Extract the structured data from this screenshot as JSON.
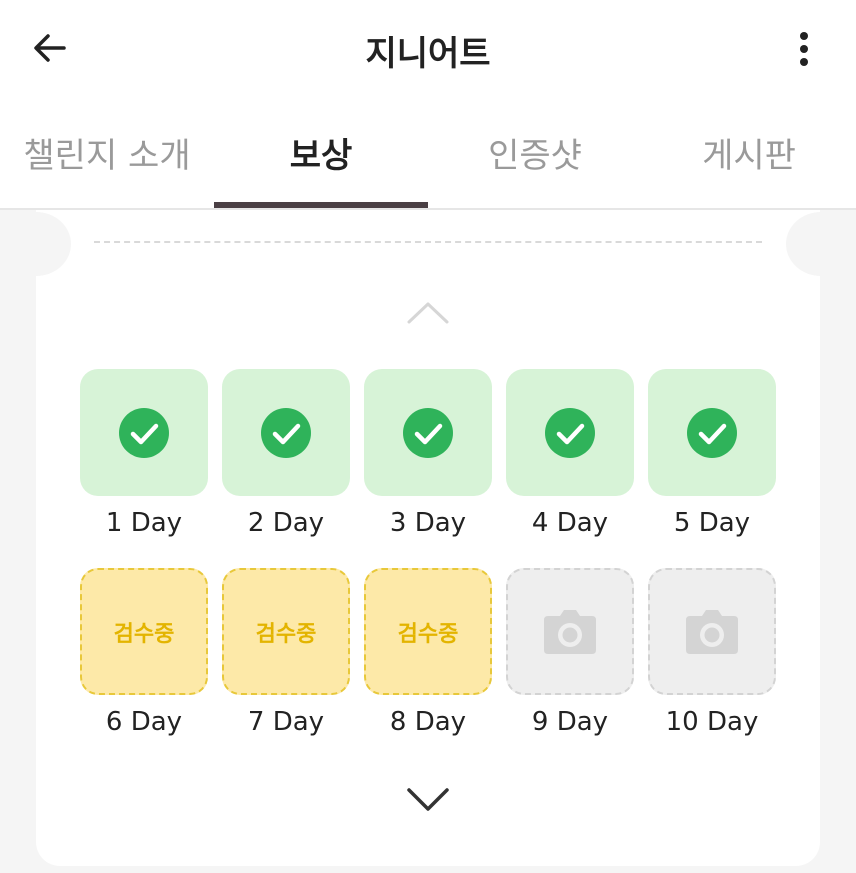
{
  "header": {
    "title": "지니어트",
    "back_icon": "arrow-left-icon",
    "more_icon": "more-vertical-icon"
  },
  "tabs": [
    {
      "label": "챌린지 소개",
      "active": false
    },
    {
      "label": "보상",
      "active": true
    },
    {
      "label": "인증샷",
      "active": false
    },
    {
      "label": "게시판",
      "active": false
    }
  ],
  "colors": {
    "done_bg": "#d7f3d7",
    "check": "#2fb35a",
    "review_bg": "#fde9a8",
    "review_text": "#e3b400",
    "empty_bg": "#eeeeee",
    "tab_indicator": "#4a3f44"
  },
  "days": [
    {
      "label": "1 Day",
      "status": "done",
      "icon": "check-circle-icon"
    },
    {
      "label": "2 Day",
      "status": "done",
      "icon": "check-circle-icon"
    },
    {
      "label": "3 Day",
      "status": "done",
      "icon": "check-circle-icon"
    },
    {
      "label": "4 Day",
      "status": "done",
      "icon": "check-circle-icon"
    },
    {
      "label": "5 Day",
      "status": "done",
      "icon": "check-circle-icon"
    },
    {
      "label": "6 Day",
      "status": "review",
      "status_text": "검수중"
    },
    {
      "label": "7 Day",
      "status": "review",
      "status_text": "검수중"
    },
    {
      "label": "8 Day",
      "status": "review",
      "status_text": "검수중"
    },
    {
      "label": "9 Day",
      "status": "empty",
      "icon": "camera-icon"
    },
    {
      "label": "10 Day",
      "status": "empty",
      "icon": "camera-icon"
    }
  ]
}
